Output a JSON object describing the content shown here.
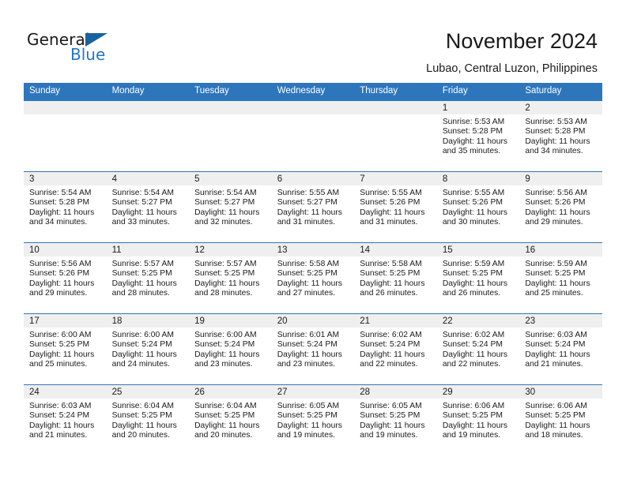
{
  "brand": {
    "name_part1": "General",
    "name_part2": "Blue",
    "accent_color": "#2176c7",
    "triangle_color": "#16639e"
  },
  "header": {
    "title": "November 2024",
    "subtitle": "Lubao, Central Luzon, Philippines"
  },
  "theme": {
    "header_blue": "#2e76bc",
    "daynum_band": "#efefef",
    "text": "#1a1a1a"
  },
  "weekdays": [
    "Sunday",
    "Monday",
    "Tuesday",
    "Wednesday",
    "Thursday",
    "Friday",
    "Saturday"
  ],
  "weeks": [
    [
      {
        "day": "",
        "sunrise": "",
        "sunset": "",
        "daylight1": "",
        "daylight2": ""
      },
      {
        "day": "",
        "sunrise": "",
        "sunset": "",
        "daylight1": "",
        "daylight2": ""
      },
      {
        "day": "",
        "sunrise": "",
        "sunset": "",
        "daylight1": "",
        "daylight2": ""
      },
      {
        "day": "",
        "sunrise": "",
        "sunset": "",
        "daylight1": "",
        "daylight2": ""
      },
      {
        "day": "",
        "sunrise": "",
        "sunset": "",
        "daylight1": "",
        "daylight2": ""
      },
      {
        "day": "1",
        "sunrise": "Sunrise: 5:53 AM",
        "sunset": "Sunset: 5:28 PM",
        "daylight1": "Daylight: 11 hours",
        "daylight2": "and 35 minutes."
      },
      {
        "day": "2",
        "sunrise": "Sunrise: 5:53 AM",
        "sunset": "Sunset: 5:28 PM",
        "daylight1": "Daylight: 11 hours",
        "daylight2": "and 34 minutes."
      }
    ],
    [
      {
        "day": "3",
        "sunrise": "Sunrise: 5:54 AM",
        "sunset": "Sunset: 5:28 PM",
        "daylight1": "Daylight: 11 hours",
        "daylight2": "and 34 minutes."
      },
      {
        "day": "4",
        "sunrise": "Sunrise: 5:54 AM",
        "sunset": "Sunset: 5:27 PM",
        "daylight1": "Daylight: 11 hours",
        "daylight2": "and 33 minutes."
      },
      {
        "day": "5",
        "sunrise": "Sunrise: 5:54 AM",
        "sunset": "Sunset: 5:27 PM",
        "daylight1": "Daylight: 11 hours",
        "daylight2": "and 32 minutes."
      },
      {
        "day": "6",
        "sunrise": "Sunrise: 5:55 AM",
        "sunset": "Sunset: 5:27 PM",
        "daylight1": "Daylight: 11 hours",
        "daylight2": "and 31 minutes."
      },
      {
        "day": "7",
        "sunrise": "Sunrise: 5:55 AM",
        "sunset": "Sunset: 5:26 PM",
        "daylight1": "Daylight: 11 hours",
        "daylight2": "and 31 minutes."
      },
      {
        "day": "8",
        "sunrise": "Sunrise: 5:55 AM",
        "sunset": "Sunset: 5:26 PM",
        "daylight1": "Daylight: 11 hours",
        "daylight2": "and 30 minutes."
      },
      {
        "day": "9",
        "sunrise": "Sunrise: 5:56 AM",
        "sunset": "Sunset: 5:26 PM",
        "daylight1": "Daylight: 11 hours",
        "daylight2": "and 29 minutes."
      }
    ],
    [
      {
        "day": "10",
        "sunrise": "Sunrise: 5:56 AM",
        "sunset": "Sunset: 5:26 PM",
        "daylight1": "Daylight: 11 hours",
        "daylight2": "and 29 minutes."
      },
      {
        "day": "11",
        "sunrise": "Sunrise: 5:57 AM",
        "sunset": "Sunset: 5:25 PM",
        "daylight1": "Daylight: 11 hours",
        "daylight2": "and 28 minutes."
      },
      {
        "day": "12",
        "sunrise": "Sunrise: 5:57 AM",
        "sunset": "Sunset: 5:25 PM",
        "daylight1": "Daylight: 11 hours",
        "daylight2": "and 28 minutes."
      },
      {
        "day": "13",
        "sunrise": "Sunrise: 5:58 AM",
        "sunset": "Sunset: 5:25 PM",
        "daylight1": "Daylight: 11 hours",
        "daylight2": "and 27 minutes."
      },
      {
        "day": "14",
        "sunrise": "Sunrise: 5:58 AM",
        "sunset": "Sunset: 5:25 PM",
        "daylight1": "Daylight: 11 hours",
        "daylight2": "and 26 minutes."
      },
      {
        "day": "15",
        "sunrise": "Sunrise: 5:59 AM",
        "sunset": "Sunset: 5:25 PM",
        "daylight1": "Daylight: 11 hours",
        "daylight2": "and 26 minutes."
      },
      {
        "day": "16",
        "sunrise": "Sunrise: 5:59 AM",
        "sunset": "Sunset: 5:25 PM",
        "daylight1": "Daylight: 11 hours",
        "daylight2": "and 25 minutes."
      }
    ],
    [
      {
        "day": "17",
        "sunrise": "Sunrise: 6:00 AM",
        "sunset": "Sunset: 5:25 PM",
        "daylight1": "Daylight: 11 hours",
        "daylight2": "and 25 minutes."
      },
      {
        "day": "18",
        "sunrise": "Sunrise: 6:00 AM",
        "sunset": "Sunset: 5:24 PM",
        "daylight1": "Daylight: 11 hours",
        "daylight2": "and 24 minutes."
      },
      {
        "day": "19",
        "sunrise": "Sunrise: 6:00 AM",
        "sunset": "Sunset: 5:24 PM",
        "daylight1": "Daylight: 11 hours",
        "daylight2": "and 23 minutes."
      },
      {
        "day": "20",
        "sunrise": "Sunrise: 6:01 AM",
        "sunset": "Sunset: 5:24 PM",
        "daylight1": "Daylight: 11 hours",
        "daylight2": "and 23 minutes."
      },
      {
        "day": "21",
        "sunrise": "Sunrise: 6:02 AM",
        "sunset": "Sunset: 5:24 PM",
        "daylight1": "Daylight: 11 hours",
        "daylight2": "and 22 minutes."
      },
      {
        "day": "22",
        "sunrise": "Sunrise: 6:02 AM",
        "sunset": "Sunset: 5:24 PM",
        "daylight1": "Daylight: 11 hours",
        "daylight2": "and 22 minutes."
      },
      {
        "day": "23",
        "sunrise": "Sunrise: 6:03 AM",
        "sunset": "Sunset: 5:24 PM",
        "daylight1": "Daylight: 11 hours",
        "daylight2": "and 21 minutes."
      }
    ],
    [
      {
        "day": "24",
        "sunrise": "Sunrise: 6:03 AM",
        "sunset": "Sunset: 5:24 PM",
        "daylight1": "Daylight: 11 hours",
        "daylight2": "and 21 minutes."
      },
      {
        "day": "25",
        "sunrise": "Sunrise: 6:04 AM",
        "sunset": "Sunset: 5:25 PM",
        "daylight1": "Daylight: 11 hours",
        "daylight2": "and 20 minutes."
      },
      {
        "day": "26",
        "sunrise": "Sunrise: 6:04 AM",
        "sunset": "Sunset: 5:25 PM",
        "daylight1": "Daylight: 11 hours",
        "daylight2": "and 20 minutes."
      },
      {
        "day": "27",
        "sunrise": "Sunrise: 6:05 AM",
        "sunset": "Sunset: 5:25 PM",
        "daylight1": "Daylight: 11 hours",
        "daylight2": "and 19 minutes."
      },
      {
        "day": "28",
        "sunrise": "Sunrise: 6:05 AM",
        "sunset": "Sunset: 5:25 PM",
        "daylight1": "Daylight: 11 hours",
        "daylight2": "and 19 minutes."
      },
      {
        "day": "29",
        "sunrise": "Sunrise: 6:06 AM",
        "sunset": "Sunset: 5:25 PM",
        "daylight1": "Daylight: 11 hours",
        "daylight2": "and 19 minutes."
      },
      {
        "day": "30",
        "sunrise": "Sunrise: 6:06 AM",
        "sunset": "Sunset: 5:25 PM",
        "daylight1": "Daylight: 11 hours",
        "daylight2": "and 18 minutes."
      }
    ]
  ]
}
